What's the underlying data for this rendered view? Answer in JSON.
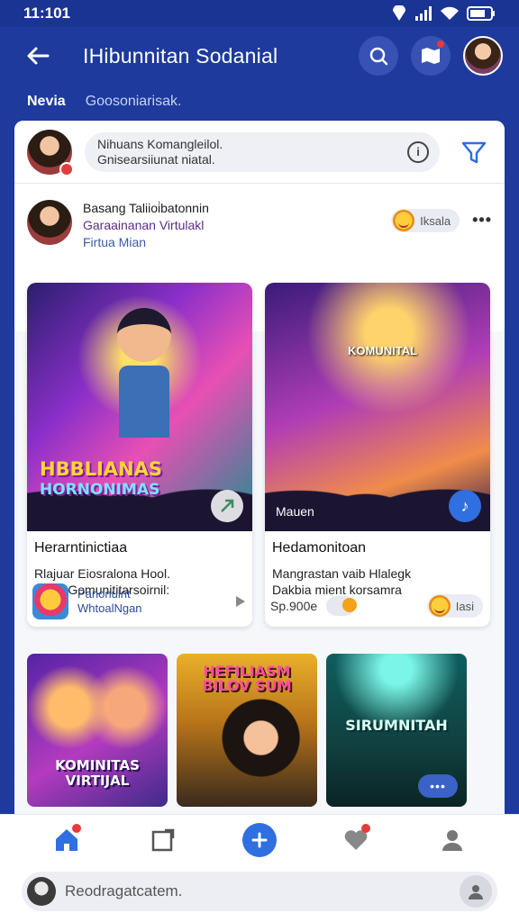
{
  "status_bar": {
    "time": "11:101"
  },
  "header": {
    "title": "IHibunnitan Sodanial"
  },
  "tabs": [
    {
      "label": "Nevia",
      "active": true
    },
    {
      "label": "Goosoniarisak.",
      "active": false
    }
  ],
  "composer": {
    "line1": "Nihuans Komangleilol.",
    "line2": "Gnisearsiiunat niatal."
  },
  "post": {
    "author": "Basang Taliioi̇batonnin",
    "subtitle": "Garaainanan Virtulakl",
    "location": "Firtua Mian",
    "reaction_label": "Iksala"
  },
  "cards": [
    {
      "banner_line1": "HBBLIANAS",
      "banner_line2": "HORNONIMAS",
      "title": "Herarntinictiaa",
      "desc_line1": "Rlajuar Eiosralona Hool.",
      "desc_line2": "suina Gomunititarsoirnil:",
      "footer_line1": "Panonulnt",
      "footer_line2": "WhtoalNgan"
    },
    {
      "image_title": "KOMUNITAL",
      "image_caption": "Mauen",
      "title": "Hedamonitoan",
      "desc_line1": "Mangrastan vaib Hlalegk",
      "desc_line2": "Dakbia mient korsamra",
      "price": "Sp.900e",
      "reaction_label": "Iasi"
    }
  ],
  "thumbs": [
    {
      "label_line1": "KOMINITAS",
      "label_line2": "VIRTIJAL"
    },
    {
      "label_line1": "HEFILIASM",
      "label_line2": "BILOV SUM"
    },
    {
      "label_line1": "SIRUMNITAH",
      "label_line2": ""
    }
  ],
  "search": {
    "placeholder": "Reodragatcatem."
  },
  "colors": {
    "brand": "#1d3a9c",
    "accent": "#2f6fe0",
    "badge": "#e63b3b"
  }
}
